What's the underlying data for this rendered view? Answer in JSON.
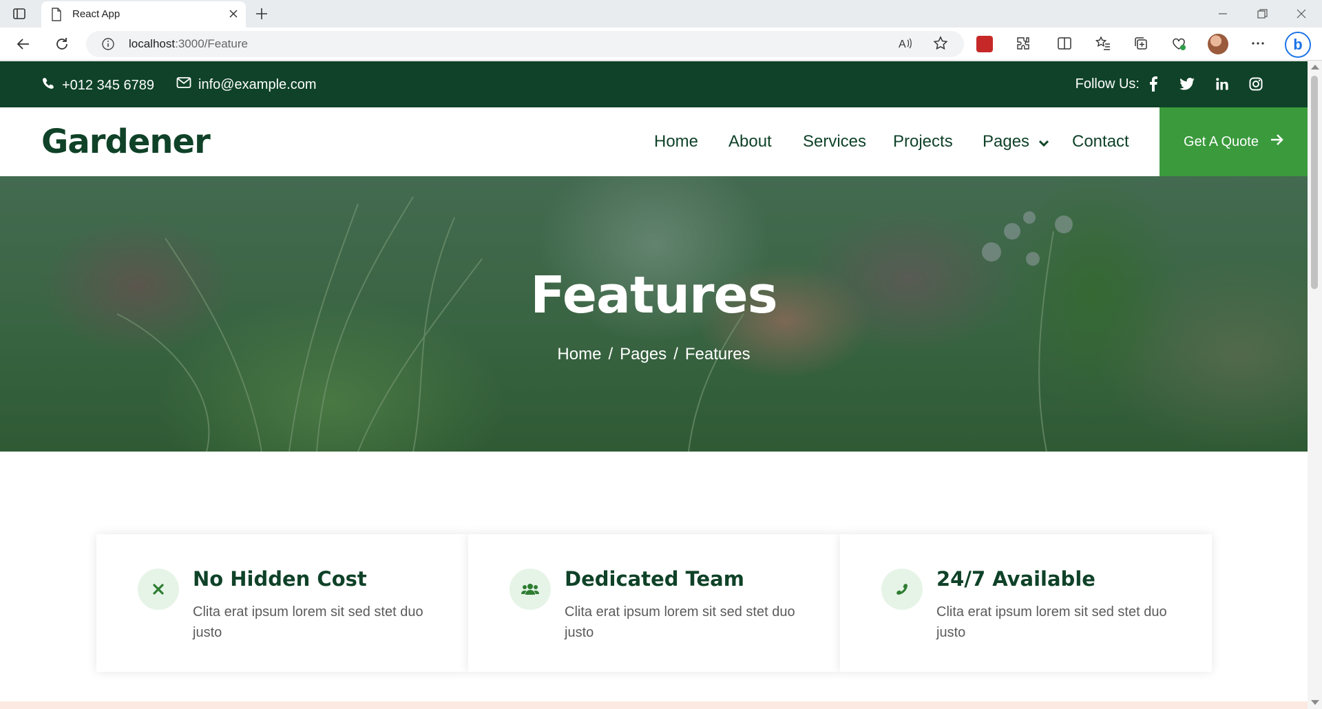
{
  "browser": {
    "tab_title": "React App",
    "url_host": "localhost",
    "url_path": ":3000/Feature"
  },
  "topbar": {
    "phone": "+012 345 6789",
    "email": "info@example.com",
    "follow_label": "Follow Us:",
    "socials": [
      "facebook-icon",
      "twitter-icon",
      "linkedin-icon",
      "instagram-icon"
    ]
  },
  "navbar": {
    "logo": "Gardener",
    "links": [
      "Home",
      "About",
      "Services",
      "Projects",
      "Pages",
      "Contact"
    ],
    "quote_button": "Get A Quote"
  },
  "hero": {
    "title": "Features",
    "breadcrumb": [
      "Home",
      "Pages",
      "Features"
    ],
    "breadcrumb_separator": "/"
  },
  "features": [
    {
      "icon": "times-icon",
      "title": "No Hidden Cost",
      "text": "Clita erat ipsum lorem sit sed stet duo justo"
    },
    {
      "icon": "users-icon",
      "title": "Dedicated Team",
      "text": "Clita erat ipsum lorem sit sed stet duo justo"
    },
    {
      "icon": "phone-icon",
      "title": "24/7 Available",
      "text": "Clita erat ipsum lorem sit sed stet duo justo"
    }
  ],
  "colors": {
    "primary_dark": "#0f4228",
    "accent_green": "#3a9a3c",
    "icon_bg": "#e6f4e7"
  }
}
